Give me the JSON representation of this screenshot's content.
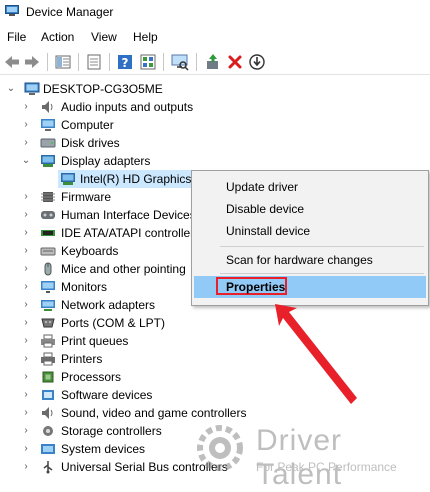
{
  "window": {
    "title": "Device Manager"
  },
  "menu": [
    "File",
    "Action",
    "View",
    "Help"
  ],
  "toolbar": {
    "buttons": [
      "back-icon",
      "forward-icon",
      "show-hide-tree-icon",
      "properties-icon",
      "help-icon",
      "update-driver-icon",
      "scan-hardware-icon",
      "enable-device-icon",
      "uninstall-icon",
      "download-icon"
    ]
  },
  "tree": {
    "root": "DESKTOP-CG3O5ME",
    "categories": [
      {
        "label": "Audio inputs and outputs",
        "icon": "audio-icon",
        "expanded": false
      },
      {
        "label": "Computer",
        "icon": "computer-icon",
        "expanded": false
      },
      {
        "label": "Disk drives",
        "icon": "disk-icon",
        "expanded": false
      },
      {
        "label": "Display adapters",
        "icon": "display-adapter-icon",
        "expanded": true
      },
      {
        "label": "Firmware",
        "icon": "firmware-icon",
        "expanded": false
      },
      {
        "label": "Human Interface Devices",
        "icon": "hid-icon",
        "expanded": false
      },
      {
        "label": "IDE ATA/ATAPI controller",
        "icon": "ide-icon",
        "expanded": false
      },
      {
        "label": "Keyboards",
        "icon": "keyboard-icon",
        "expanded": false
      },
      {
        "label": "Mice and other pointing",
        "icon": "mouse-icon",
        "expanded": false
      },
      {
        "label": "Monitors",
        "icon": "monitor-icon",
        "expanded": false
      },
      {
        "label": "Network adapters",
        "icon": "network-icon",
        "expanded": false
      },
      {
        "label": "Ports (COM & LPT)",
        "icon": "port-icon",
        "expanded": false
      },
      {
        "label": "Print queues",
        "icon": "print-queue-icon",
        "expanded": false
      },
      {
        "label": "Printers",
        "icon": "printer-icon",
        "expanded": false
      },
      {
        "label": "Processors",
        "icon": "processor-icon",
        "expanded": false
      },
      {
        "label": "Software devices",
        "icon": "software-device-icon",
        "expanded": false
      },
      {
        "label": "Sound, video and game controllers",
        "icon": "sound-icon",
        "expanded": false
      },
      {
        "label": "Storage controllers",
        "icon": "storage-icon",
        "expanded": false
      },
      {
        "label": "System devices",
        "icon": "system-icon",
        "expanded": false
      },
      {
        "label": "Universal Serial Bus controllers",
        "icon": "usb-icon",
        "expanded": false
      }
    ],
    "selected_device": "Intel(R) HD Graphics"
  },
  "context_menu": {
    "items": [
      "Update driver",
      "Disable device",
      "Uninstall device"
    ],
    "scan": "Scan for hardware changes",
    "properties": "Properties"
  },
  "watermark": {
    "title": "Driver Talent",
    "subtitle": "For Peak PC Performance"
  },
  "colors": {
    "selection": "#cce8ff",
    "menu_highlight": "#91c9f7",
    "annotation_red": "#e8202a"
  }
}
